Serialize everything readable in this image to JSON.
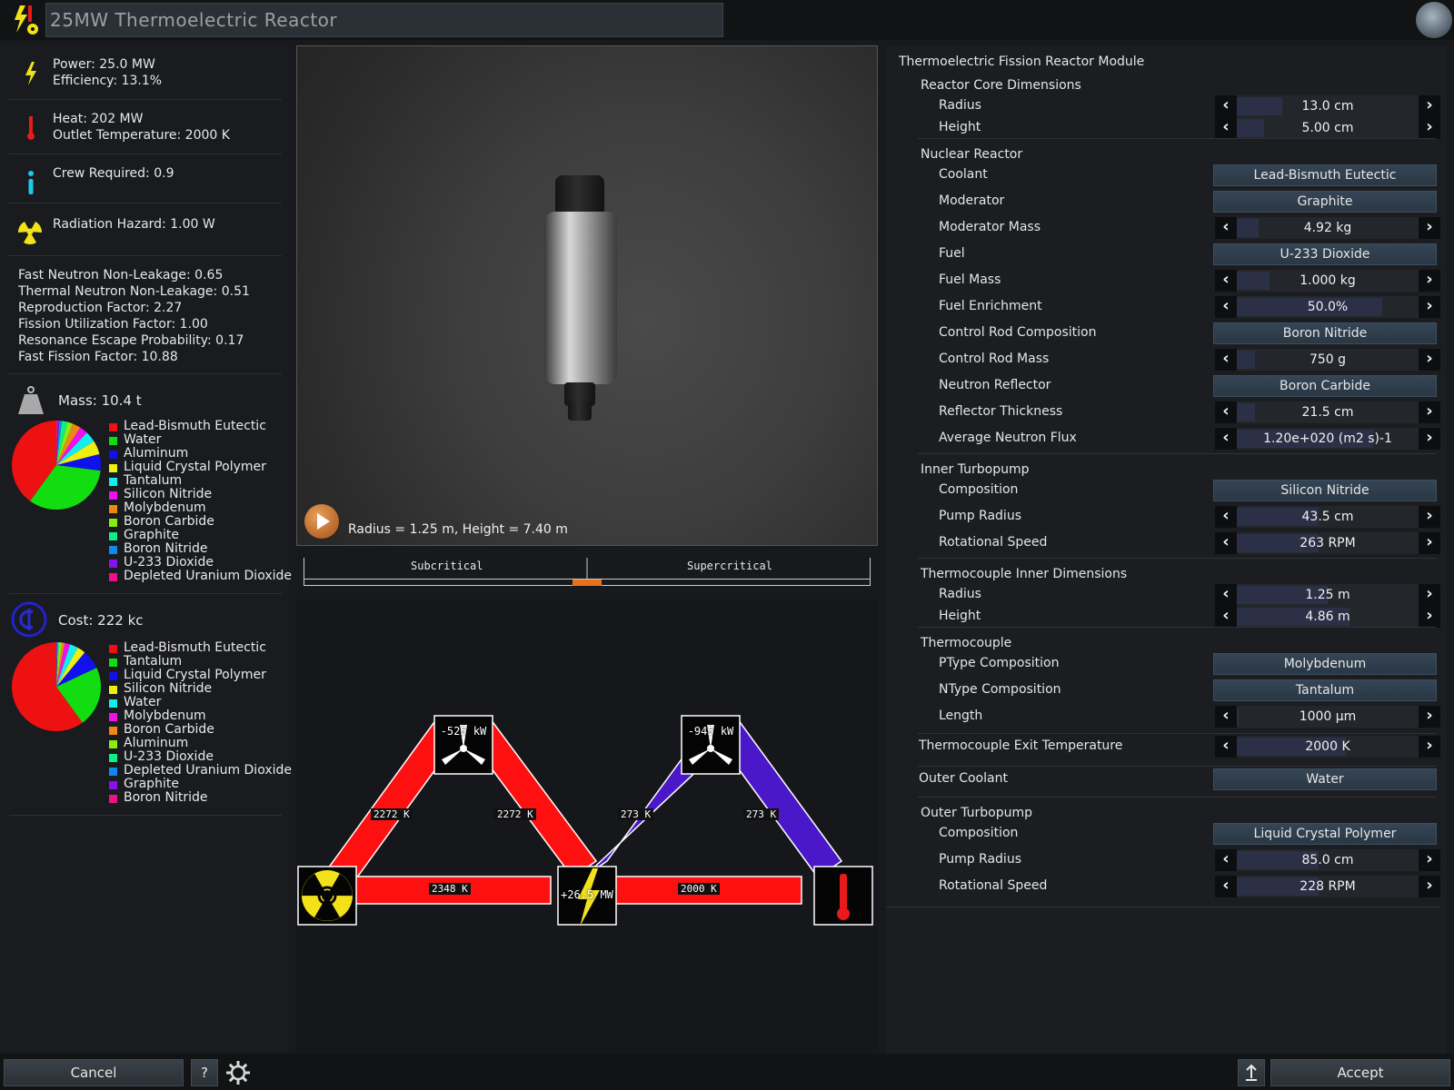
{
  "window": {
    "title": "25MW Thermoelectric Reactor"
  },
  "stats": {
    "power": "Power: 25.0 MW",
    "efficiency": "Efficiency: 13.1%",
    "heat": "Heat: 202 MW",
    "outlet_temp": "Outlet Temperature: 2000 K",
    "crew": "Crew Required: 0.9",
    "radiation": "Radiation Hazard: 1.00 W"
  },
  "factors": [
    "Fast Neutron Non-Leakage: 0.65",
    "Thermal Neutron Non-Leakage: 0.51",
    "Reproduction Factor: 2.27",
    "Fission Utilization Factor: 1.00",
    "Resonance Escape Probability: 0.17",
    "Fast Fission Factor: 10.88"
  ],
  "mass": {
    "label": "Mass: 10.4 t",
    "pie_fractions": [
      0.4,
      0.33,
      0.06,
      0.05,
      0.04,
      0.03,
      0.03,
      0.02,
      0.02,
      0.01,
      0.005,
      0.005
    ],
    "legend": [
      {
        "name": "Lead-Bismuth Eutectic",
        "color": "#ee1111"
      },
      {
        "name": "Water",
        "color": "#11dd11"
      },
      {
        "name": "Aluminum",
        "color": "#1111ee"
      },
      {
        "name": "Liquid Crystal Polymer",
        "color": "#eeee11"
      },
      {
        "name": "Tantalum",
        "color": "#11eeee"
      },
      {
        "name": "Silicon Nitride",
        "color": "#ee11ee"
      },
      {
        "name": "Molybdenum",
        "color": "#ee8811"
      },
      {
        "name": "Boron Carbide",
        "color": "#88ee11"
      },
      {
        "name": "Graphite",
        "color": "#11ee88"
      },
      {
        "name": "Boron Nitride",
        "color": "#1188ee"
      },
      {
        "name": "U-233 Dioxide",
        "color": "#8811ee"
      },
      {
        "name": "Depleted Uranium Dioxide",
        "color": "#ee1188"
      }
    ]
  },
  "cost": {
    "label": "Cost: 222 kc",
    "pie_fractions": [
      0.6,
      0.22,
      0.07,
      0.03,
      0.03,
      0.02,
      0.01,
      0.01,
      0.005,
      0.003,
      0.002
    ],
    "legend": [
      {
        "name": "Lead-Bismuth Eutectic",
        "color": "#ee1111"
      },
      {
        "name": "Tantalum",
        "color": "#11dd11"
      },
      {
        "name": "Liquid Crystal Polymer",
        "color": "#1111ee"
      },
      {
        "name": "Silicon Nitride",
        "color": "#eeee11"
      },
      {
        "name": "Water",
        "color": "#11eeee"
      },
      {
        "name": "Molybdenum",
        "color": "#ee11ee"
      },
      {
        "name": "Boron Carbide",
        "color": "#ee8811"
      },
      {
        "name": "Aluminum",
        "color": "#88ee11"
      },
      {
        "name": "U-233 Dioxide",
        "color": "#11ee88"
      },
      {
        "name": "Depleted Uranium Dioxide",
        "color": "#1188ee"
      },
      {
        "name": "Graphite",
        "color": "#8811ee"
      },
      {
        "name": "Boron Nitride",
        "color": "#ee1188"
      }
    ]
  },
  "viewport": {
    "dims": "Radius = 1.25 m, Height = 7.40 m"
  },
  "criticality": {
    "left": "Subcritical",
    "right": "Supercritical",
    "indicator_fraction": 0.5
  },
  "diagram": {
    "pump1": "-525 kW",
    "pump2": "-945 kW",
    "gen": "+26.5 MW",
    "t1": "2272 K",
    "t2": "2272 K",
    "t3": "273 K",
    "t4": "273 K",
    "t5": "2348 K",
    "t6": "2000 K",
    "hot_color": "#ff1010",
    "cold_color": "#4a18c8"
  },
  "module": {
    "title": "Thermoelectric Fission Reactor Module",
    "rows": [
      {
        "kind": "section",
        "label": "Reactor Core Dimensions"
      },
      {
        "kind": "stepper",
        "label": "Radius",
        "value": "13.0 cm",
        "fill": 0.25
      },
      {
        "kind": "stepper",
        "label": "Height",
        "value": "5.00 cm",
        "fill": 0.15
      },
      {
        "kind": "section",
        "label": "Nuclear Reactor"
      },
      {
        "kind": "select",
        "label": "Coolant",
        "value": "Lead-Bismuth Eutectic"
      },
      {
        "kind": "select",
        "label": "Moderator",
        "value": "Graphite"
      },
      {
        "kind": "stepper",
        "label": "Moderator Mass",
        "value": "4.92 kg",
        "fill": 0.12
      },
      {
        "kind": "select",
        "label": "Fuel",
        "value": "U-233 Dioxide"
      },
      {
        "kind": "stepper",
        "label": "Fuel Mass",
        "value": "1.000 kg",
        "fill": 0.18
      },
      {
        "kind": "stepper",
        "label": "Fuel Enrichment",
        "value": "50.0%",
        "fill": 0.8
      },
      {
        "kind": "select",
        "label": "Control Rod Composition",
        "value": "Boron Nitride"
      },
      {
        "kind": "stepper",
        "label": "Control Rod Mass",
        "value": "750 g",
        "fill": 0.1
      },
      {
        "kind": "select",
        "label": "Neutron Reflector",
        "value": "Boron Carbide"
      },
      {
        "kind": "stepper",
        "label": "Reflector Thickness",
        "value": "21.5 cm",
        "fill": 0.1
      },
      {
        "kind": "stepper",
        "label": "Average Neutron Flux",
        "value": "1.20e+020 (m2 s)-1",
        "fill": 0.75
      },
      {
        "kind": "section",
        "label": "Inner Turbopump"
      },
      {
        "kind": "select",
        "label": "Composition",
        "value": "Silicon Nitride"
      },
      {
        "kind": "stepper",
        "label": "Pump Radius",
        "value": "43.5 cm",
        "fill": 0.45
      },
      {
        "kind": "stepper",
        "label": "Rotational Speed",
        "value": "263 RPM",
        "fill": 0.45
      },
      {
        "kind": "section",
        "label": "Thermocouple Inner Dimensions"
      },
      {
        "kind": "stepper",
        "label": "Radius",
        "value": "1.25 m",
        "fill": 0.5
      },
      {
        "kind": "stepper",
        "label": "Height",
        "value": "4.86 m",
        "fill": 0.62
      },
      {
        "kind": "section",
        "label": "Thermocouple"
      },
      {
        "kind": "select",
        "label": "PType Composition",
        "value": "Molybdenum"
      },
      {
        "kind": "select",
        "label": "NType Composition",
        "value": "Tantalum"
      },
      {
        "kind": "stepper",
        "label": "Length",
        "value": "1000 µm",
        "fill": 0.0
      },
      {
        "kind": "stepper-top",
        "label": "Thermocouple Exit Temperature",
        "value": "2000 K",
        "fill": 0.6
      },
      {
        "kind": "select-top",
        "label": "Outer Coolant",
        "value": "Water"
      },
      {
        "kind": "section",
        "label": "Outer Turbopump"
      },
      {
        "kind": "select",
        "label": "Composition",
        "value": "Liquid Crystal Polymer"
      },
      {
        "kind": "stepper",
        "label": "Pump Radius",
        "value": "85.0 cm",
        "fill": 0.45
      },
      {
        "kind": "stepper",
        "label": "Rotational Speed",
        "value": "228 RPM",
        "fill": 0.45
      }
    ]
  },
  "buttons": {
    "cancel": "Cancel",
    "help": "?",
    "accept": "Accept"
  }
}
